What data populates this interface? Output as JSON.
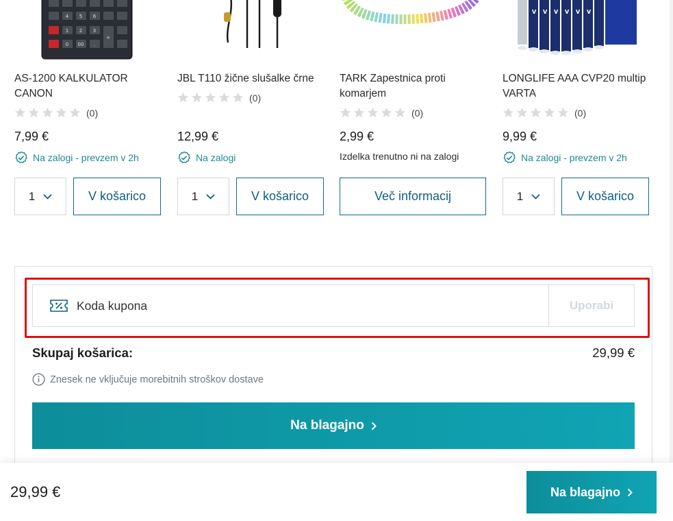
{
  "products": [
    {
      "name": "AS-1200 KALKULATOR CANON",
      "rating_count": "(0)",
      "price": "7,99 €",
      "stock": "Na zalogi - prevzem v 2h",
      "in_stock": true,
      "qty": "1",
      "action": "V košarico"
    },
    {
      "name": "JBL T110 žične slušalke črne",
      "rating_count": "(0)",
      "price": "12,99 €",
      "stock": "Na zalogi",
      "in_stock": true,
      "qty": "1",
      "action": "V košarico"
    },
    {
      "name": "TARK Zapestnica proti komarjem",
      "rating_count": "(0)",
      "price": "2,99 €",
      "stock": "Izdelka trenutno ni na zalogi",
      "in_stock": false,
      "action": "Več informacij"
    },
    {
      "name": "LONGLIFE AAA CVP20 multip VARTA",
      "rating_count": "(0)",
      "price": "9,99 €",
      "stock": "Na zalogi - prevzem v 2h",
      "in_stock": true,
      "qty": "1",
      "action": "V košarico"
    }
  ],
  "coupon": {
    "placeholder": "Koda kupona",
    "apply": "Uporabi"
  },
  "summary": {
    "total_label": "Skupaj košarica:",
    "total_value": "29,99 €",
    "note": "Znesek ne vključuje morebitnih stroškov dostave",
    "checkout": "Na blagajno"
  },
  "sticky": {
    "total": "29,99 €",
    "checkout": "Na blagajno"
  },
  "colors": {
    "accent": "#10a4b4",
    "outline": "#0f6a89",
    "highlight": "#e01010",
    "stock_green": "#1d8a8f"
  }
}
